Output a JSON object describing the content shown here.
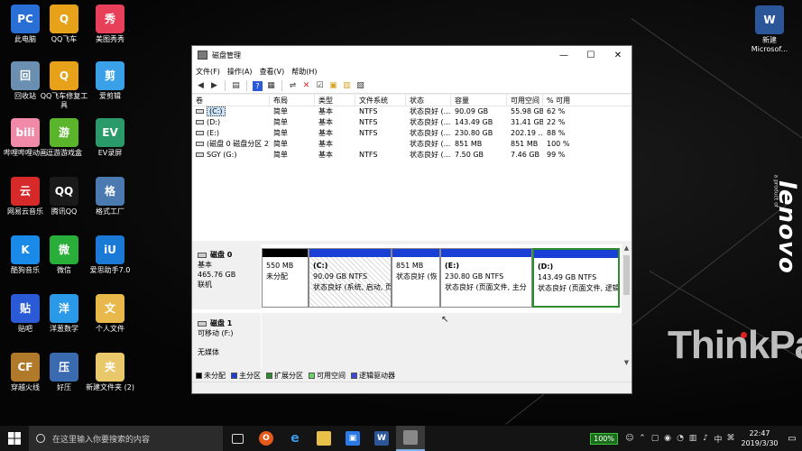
{
  "desktop": {
    "icons": [
      {
        "label": "此电脑",
        "color": "#2a6fd6",
        "glyph": "PC"
      },
      {
        "label": "QQ飞车",
        "color": "#e8a21a",
        "glyph": "Q"
      },
      {
        "label": "美图秀秀",
        "color": "#e8405a",
        "glyph": "秀"
      },
      {
        "label": "回收站",
        "color": "#6a8fb0",
        "glyph": "回"
      },
      {
        "label": "QQ飞车修复工具",
        "color": "#e8a21a",
        "glyph": "Q"
      },
      {
        "label": "爱剪辑",
        "color": "#3aa0e8",
        "glyph": "剪"
      },
      {
        "label": "哔哩哔哩动画",
        "color": "#f08aa8",
        "glyph": "bili"
      },
      {
        "label": "逗游游戏盒",
        "color": "#5ab52a",
        "glyph": "游"
      },
      {
        "label": "EV录屏",
        "color": "#2a9a6a",
        "glyph": "EV"
      },
      {
        "label": "网易云音乐",
        "color": "#d62a2a",
        "glyph": "云"
      },
      {
        "label": "腾讯QQ",
        "color": "#1a1a1a",
        "glyph": "QQ"
      },
      {
        "label": "格式工厂",
        "color": "#4a7ab0",
        "glyph": "格"
      },
      {
        "label": "酷狗音乐",
        "color": "#1a8ae8",
        "glyph": "K"
      },
      {
        "label": "微信",
        "color": "#2aae3a",
        "glyph": "微"
      },
      {
        "label": "爱思助手7.0",
        "color": "#1a7ad6",
        "glyph": "iU"
      },
      {
        "label": "贴吧",
        "color": "#2a5ad6",
        "glyph": "贴"
      },
      {
        "label": "洋葱数学",
        "color": "#2a9ae8",
        "glyph": "洋"
      },
      {
        "label": "个人文件",
        "color": "#e8b84a",
        "glyph": "文"
      },
      {
        "label": "穿越火线",
        "color": "#b07a2a",
        "glyph": "CF"
      },
      {
        "label": "好压",
        "color": "#3a6ab0",
        "glyph": "压"
      },
      {
        "label": "新建文件夹 (2)",
        "color": "#e8c86a",
        "glyph": "夹"
      }
    ],
    "word_file": {
      "label": "新建 Microsof...",
      "color": "#2b579a",
      "glyph": "W"
    },
    "lenovo_text": "lenovo",
    "lenovo_tagline": "a product of",
    "thinkpad_text": "ThinkPad"
  },
  "window": {
    "title": "磁盘管理",
    "minimize": "—",
    "maximize": "☐",
    "close": "✕",
    "menu": [
      "文件(F)",
      "操作(A)",
      "查看(V)",
      "帮助(H)"
    ],
    "columns": [
      "卷",
      "布局",
      "类型",
      "文件系统",
      "状态",
      "容量",
      "可用空间",
      "% 可用"
    ],
    "volumes": [
      {
        "name": "(C:)",
        "layout": "简单",
        "type": "基本",
        "fs": "NTFS",
        "status": "状态良好 (...",
        "capacity": "90.09 GB",
        "free": "55.98 GB",
        "pct": "62 %"
      },
      {
        "name": "(D:)",
        "layout": "简单",
        "type": "基本",
        "fs": "NTFS",
        "status": "状态良好 (...",
        "capacity": "143.49 GB",
        "free": "31.41 GB",
        "pct": "22 %"
      },
      {
        "name": "(E:)",
        "layout": "简单",
        "type": "基本",
        "fs": "NTFS",
        "status": "状态良好 (...",
        "capacity": "230.80 GB",
        "free": "202.19 ...",
        "pct": "88 %"
      },
      {
        "name": "(磁盘 0 磁盘分区 2)",
        "layout": "简单",
        "type": "基本",
        "fs": "",
        "status": "状态良好 (...",
        "capacity": "851 MB",
        "free": "851 MB",
        "pct": "100 %"
      },
      {
        "name": "SGY (G:)",
        "layout": "简单",
        "type": "基本",
        "fs": "NTFS",
        "status": "状态良好 (...",
        "capacity": "7.50 GB",
        "free": "7.46 GB",
        "pct": "99 %"
      }
    ],
    "disk0": {
      "name": "磁盘 0",
      "kind": "基本",
      "size": "465.76 GB",
      "state": "联机",
      "partitions": [
        {
          "title": "",
          "line1": "550 MB",
          "line2": "未分配"
        },
        {
          "title": "(C:)",
          "line1": "90.09 GB NTFS",
          "line2": "状态良好 (系统, 启动, 页"
        },
        {
          "title": "",
          "line1": "851 MB",
          "line2": "状态良好 (恢"
        },
        {
          "title": "(E:)",
          "line1": "230.80 GB NTFS",
          "line2": "状态良好 (页面文件, 主分"
        },
        {
          "title": "(D:)",
          "line1": "143.49 GB NTFS",
          "line2": "状态良好 (页面文件, 逻辑"
        }
      ]
    },
    "disk1": {
      "name": "磁盘 1",
      "kind": "可移动 (F:)",
      "media": "无媒体"
    },
    "legend": [
      {
        "label": "未分配",
        "color": "#000000"
      },
      {
        "label": "主分区",
        "color": "#1a3fd6"
      },
      {
        "label": "扩展分区",
        "color": "#2e8b2e"
      },
      {
        "label": "可用空间",
        "color": "#6ad66a"
      },
      {
        "label": "逻辑驱动器",
        "color": "#3a4ad6"
      }
    ]
  },
  "taskbar": {
    "search_placeholder": "在这里输入你要搜索的内容",
    "battery": "100%",
    "ime": "中",
    "time": "22:47",
    "date": "2019/3/30"
  }
}
